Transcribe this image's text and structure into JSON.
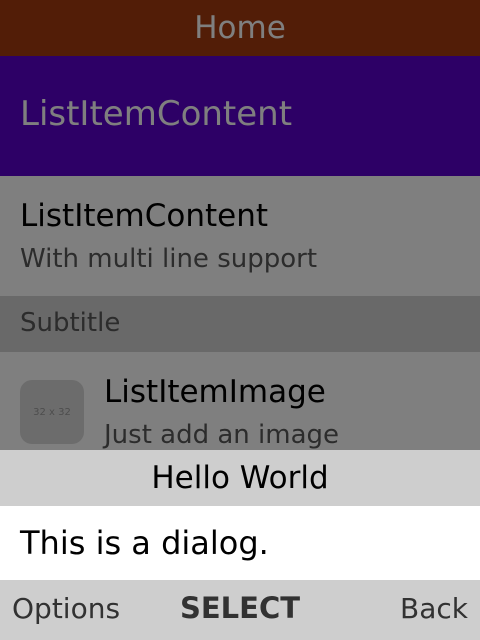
{
  "header": {
    "title": "Home"
  },
  "list": {
    "focused_item": {
      "title": "ListItemContent"
    },
    "multi_item": {
      "title": "ListItemContent",
      "description": "With multi line support"
    },
    "subtitle": "Subtitle",
    "image_item": {
      "title": "ListItemImage",
      "description": "Just add an image",
      "thumb_text": "32 x 32"
    }
  },
  "dialog": {
    "title": "Hello World",
    "message": "This is a dialog."
  },
  "softkeys": {
    "left": "Options",
    "center": "SELECT",
    "right": "Back"
  },
  "colors": {
    "header": "#a53a0f",
    "focused": "#5a00cc",
    "overlay": "rgba(0,0,0,0.5)"
  }
}
